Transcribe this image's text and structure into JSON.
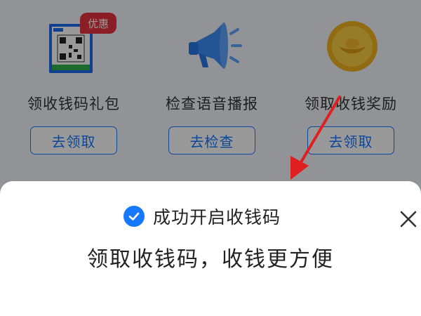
{
  "features": [
    {
      "label": "领收钱码礼包",
      "button": "去领取",
      "badge": "优惠",
      "icon": "qr-code-pack-icon"
    },
    {
      "label": "检查语音播报",
      "button": "去检查",
      "icon": "megaphone-icon"
    },
    {
      "label": "领取收钱奖励",
      "button": "去领取",
      "icon": "gold-ingot-coin-icon"
    }
  ],
  "sheet": {
    "title": "成功开启收钱码",
    "subtitle": "领取收钱码，收钱更方便",
    "status_icon": "check-circle-icon",
    "close_icon": "close-icon"
  },
  "colors": {
    "accent": "#1677ff",
    "badge": "#e8323c",
    "arrow": "#e02020",
    "overlay": "rgba(0,0,0,0.40)"
  }
}
